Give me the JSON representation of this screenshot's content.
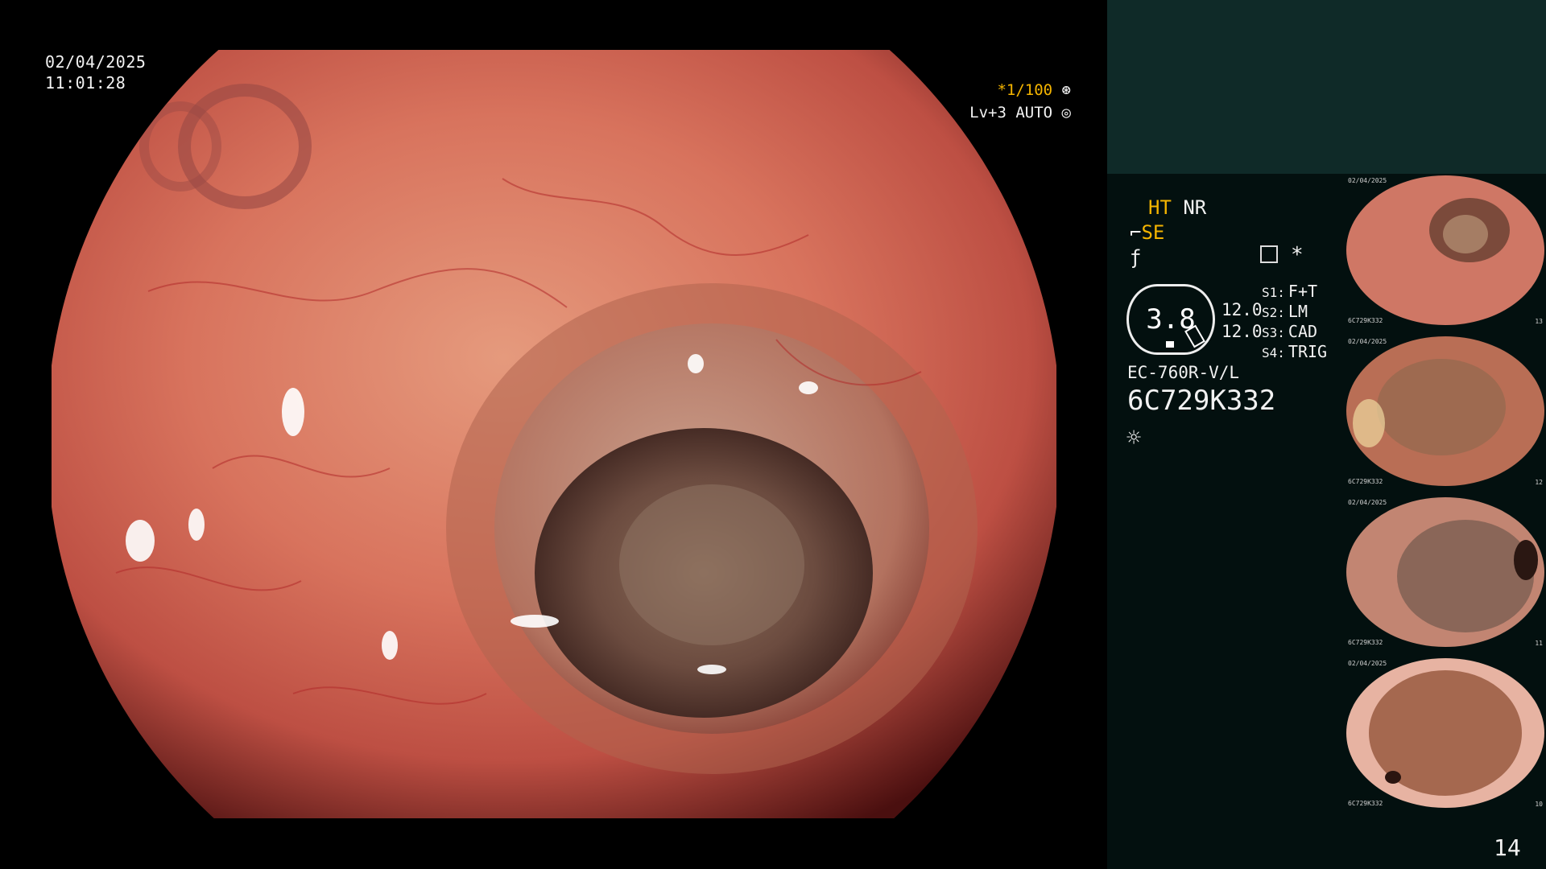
{
  "overlay": {
    "date": "02/04/2025",
    "time": "11:01:28",
    "shutter": "*1/100",
    "level": "Lv+3 AUTO"
  },
  "sidebar": {
    "mode_primary": "HT",
    "mode_secondary": "NR",
    "mode_se": "SE",
    "zoom_value": "3.8",
    "gain_1": "12.0",
    "gain_2": "12.0",
    "settings": [
      {
        "key": "S1:",
        "value": "F+T"
      },
      {
        "key": "S2:",
        "value": "LM"
      },
      {
        "key": "S3:",
        "value": "CAD"
      },
      {
        "key": "S4:",
        "value": "TRIG"
      }
    ],
    "scope_model": "EC-760R-V/L",
    "scope_serial": "6C729K332",
    "page_number": "14"
  },
  "thumbnails": [
    {
      "tiny_date": "02/04/2025",
      "tiny_serial": "6C729K332",
      "tiny_num": "13"
    },
    {
      "tiny_date": "02/04/2025",
      "tiny_serial": "6C729K332",
      "tiny_num": "12"
    },
    {
      "tiny_date": "02/04/2025",
      "tiny_serial": "6C729K332",
      "tiny_num": "11"
    },
    {
      "tiny_date": "02/04/2025",
      "tiny_serial": "6C729K332",
      "tiny_num": "10"
    }
  ],
  "colors": {
    "accent": "#f4b400",
    "sidebar_bg": "#03100f",
    "header_bg": "#0f2a28",
    "mucosa": "#b84d3f"
  },
  "icons": {
    "shutter": "aperture-icon",
    "level": "gear-icon",
    "settings": "settings-icon",
    "star": "asterisk-icon",
    "light": "sun-icon"
  }
}
